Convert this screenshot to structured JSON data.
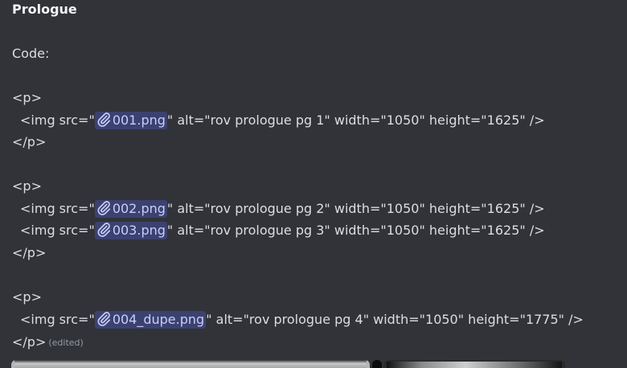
{
  "message": {
    "heading": "Prologue",
    "code_label": "Code:",
    "p_open": "<p>",
    "p_close": "</p>",
    "img_prefix": "<img src=\"",
    "edited": "(edited)",
    "files": [
      {
        "name": "001.png",
        "suffix": "\" alt=\"rov prologue pg 1\" width=\"1050\" height=\"1625\" />"
      },
      {
        "name": "002.png",
        "suffix": "\" alt=\"rov prologue pg 2\" width=\"1050\" height=\"1625\" />"
      },
      {
        "name": "003.png",
        "suffix": "\" alt=\"rov prologue pg 3\" width=\"1050\" height=\"1625\" />"
      },
      {
        "name": "004_dupe.png",
        "suffix": "\" alt=\"rov prologue pg 4\" width=\"1050\" height=\"1775\" />"
      }
    ]
  },
  "icons": {
    "attachment_link": "paperclip-icon"
  },
  "colors": {
    "background": "#313338",
    "text": "#dbdee1",
    "link_chip_bg": "#3c4270",
    "link_chip_text": "#c9cdfb"
  }
}
